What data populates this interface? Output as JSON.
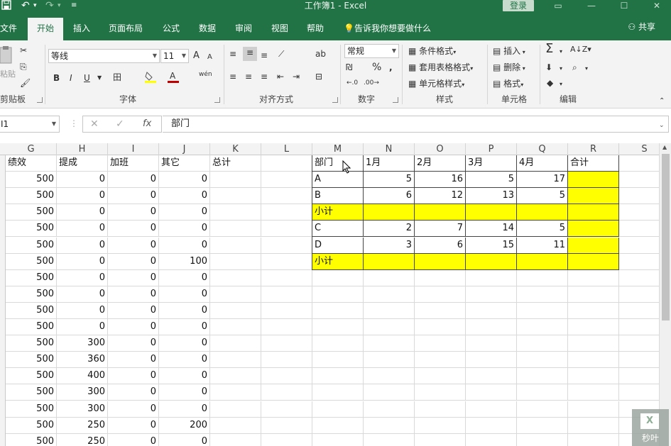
{
  "window": {
    "title": "工作簿1  -  Excel",
    "login_label": "登录"
  },
  "ribbon_tabs": [
    {
      "label": "文件"
    },
    {
      "label": "开始"
    },
    {
      "label": "插入"
    },
    {
      "label": "页面布局"
    },
    {
      "label": "公式"
    },
    {
      "label": "数据"
    },
    {
      "label": "审阅"
    },
    {
      "label": "视图"
    },
    {
      "label": "帮助"
    }
  ],
  "tell_me": "告诉我你想要做什么",
  "share_label": "共享",
  "ribbon": {
    "clipboard": {
      "label": "剪贴板",
      "paste_label": "粘贴"
    },
    "font": {
      "label": "字体",
      "font_name": "等线",
      "font_size": "11",
      "bold": "B",
      "italic": "I",
      "underline": "U",
      "grow": "A",
      "shrink": "A",
      "wen": "wén"
    },
    "alignment": {
      "label": "对齐方式"
    },
    "number": {
      "label": "数字",
      "format": "常规",
      "percent": "%",
      "comma": ","
    },
    "styles": {
      "label": "样式",
      "cond_format": "条件格式",
      "table_format": "套用表格格式",
      "cell_styles": "单元格样式"
    },
    "cells": {
      "label": "单元格",
      "insert": "插入",
      "delete": "删除",
      "format": "格式"
    },
    "editing": {
      "label": "编辑"
    }
  },
  "formula_bar": {
    "name_box": "I1",
    "content": "部门"
  },
  "columns": [
    "G",
    "H",
    "I",
    "J",
    "K",
    "L",
    "M",
    "N",
    "O",
    "P",
    "Q",
    "R",
    "S"
  ],
  "left_table": {
    "headers": [
      "绩效",
      "提成",
      "加班",
      "其它",
      "总计"
    ],
    "rows": [
      [
        "500",
        "0",
        "0",
        "0"
      ],
      [
        "500",
        "0",
        "0",
        "0"
      ],
      [
        "500",
        "0",
        "0",
        "0"
      ],
      [
        "500",
        "0",
        "0",
        "0"
      ],
      [
        "500",
        "0",
        "0",
        "0"
      ],
      [
        "500",
        "0",
        "0",
        "100"
      ],
      [
        "500",
        "0",
        "0",
        "0"
      ],
      [
        "500",
        "0",
        "0",
        "0"
      ],
      [
        "500",
        "0",
        "0",
        "0"
      ],
      [
        "500",
        "0",
        "0",
        "0"
      ],
      [
        "500",
        "300",
        "0",
        "0"
      ],
      [
        "500",
        "360",
        "0",
        "0"
      ],
      [
        "500",
        "400",
        "0",
        "0"
      ],
      [
        "500",
        "300",
        "0",
        "0"
      ],
      [
        "500",
        "300",
        "0",
        "0"
      ],
      [
        "500",
        "250",
        "0",
        "200"
      ],
      [
        "500",
        "250",
        "0",
        "0"
      ]
    ]
  },
  "right_table": {
    "headers": [
      "部门",
      "1月",
      "2月",
      "3月",
      "4月",
      "合计"
    ],
    "rows": [
      {
        "label": "A",
        "values": [
          "5",
          "16",
          "5",
          "17"
        ],
        "subtotal": false
      },
      {
        "label": "B",
        "values": [
          "6",
          "12",
          "13",
          "5"
        ],
        "subtotal": false
      },
      {
        "label": "小计",
        "values": [
          "",
          "",
          "",
          ""
        ],
        "subtotal": true
      },
      {
        "label": "C",
        "values": [
          "2",
          "7",
          "14",
          "5"
        ],
        "subtotal": false
      },
      {
        "label": "D",
        "values": [
          "3",
          "6",
          "15",
          "11"
        ],
        "subtotal": false
      },
      {
        "label": "小计",
        "values": [
          "",
          "",
          "",
          ""
        ],
        "subtotal": true
      }
    ]
  },
  "watermark": {
    "icon": "X",
    "text": "秒叶"
  },
  "colors": {
    "brand": "#217346",
    "highlight": "#ffff00"
  }
}
